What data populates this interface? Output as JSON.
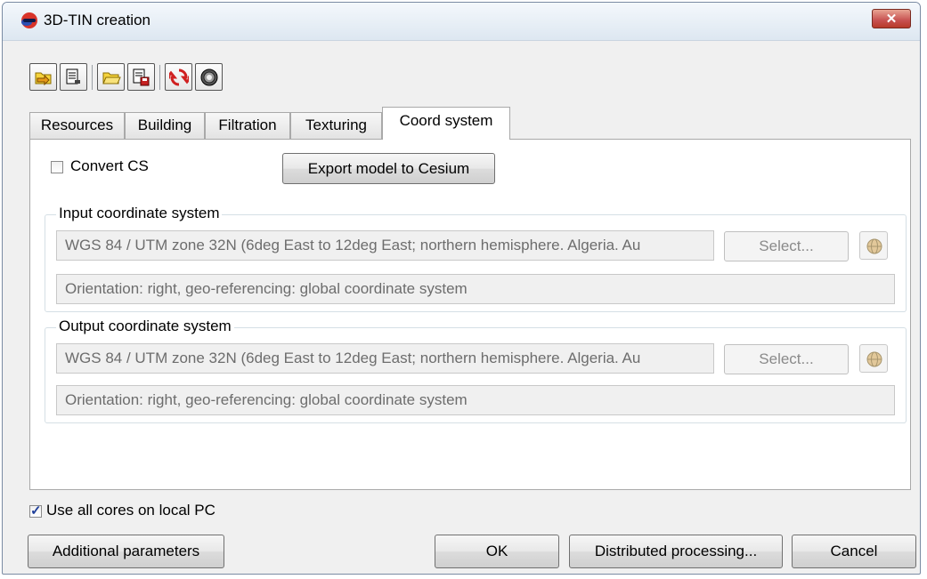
{
  "window": {
    "title": "3D-TIN creation",
    "close_glyph": "✕"
  },
  "toolbar": {
    "buttons": [
      {
        "icon": "open-folder-arrow-icon"
      },
      {
        "icon": "save-document-arrow-icon"
      },
      {
        "icon": "open-folder-icon"
      },
      {
        "icon": "save-floppy-icon"
      },
      {
        "icon": "refresh-icon"
      },
      {
        "icon": "reset-settings-icon"
      }
    ]
  },
  "tabs": [
    "Resources",
    "Building",
    "Filtration",
    "Texturing",
    "Coord system"
  ],
  "active_tab": "Coord system",
  "coord": {
    "convert_label": "Convert CS",
    "convert_checked": false,
    "export_button": "Export model to Cesium",
    "input": {
      "title": "Input coordinate system",
      "cs_value": "WGS 84 / UTM zone 32N (6deg East to 12deg East; northern hemisphere. Algeria. Au",
      "select_label": "Select...",
      "orientation": "Orientation: right, geo-referencing: global coordinate system"
    },
    "output": {
      "title": "Output coordinate system",
      "cs_value": "WGS 84 / UTM zone 32N (6deg East to 12deg East; northern hemisphere. Algeria. Au",
      "select_label": "Select...",
      "orientation": "Orientation: right, geo-referencing: global coordinate system"
    }
  },
  "footer": {
    "use_cores_label": "Use all cores on local PC",
    "use_cores_checked": true,
    "additional_button": "Additional parameters",
    "ok_button": "OK",
    "distributed_button": "Distributed processing...",
    "cancel_button": "Cancel"
  },
  "colors": {
    "accent": "#1f3f9a",
    "close": "#c75050",
    "panel": "#ffffff",
    "dialog": "#f0f0f0"
  }
}
